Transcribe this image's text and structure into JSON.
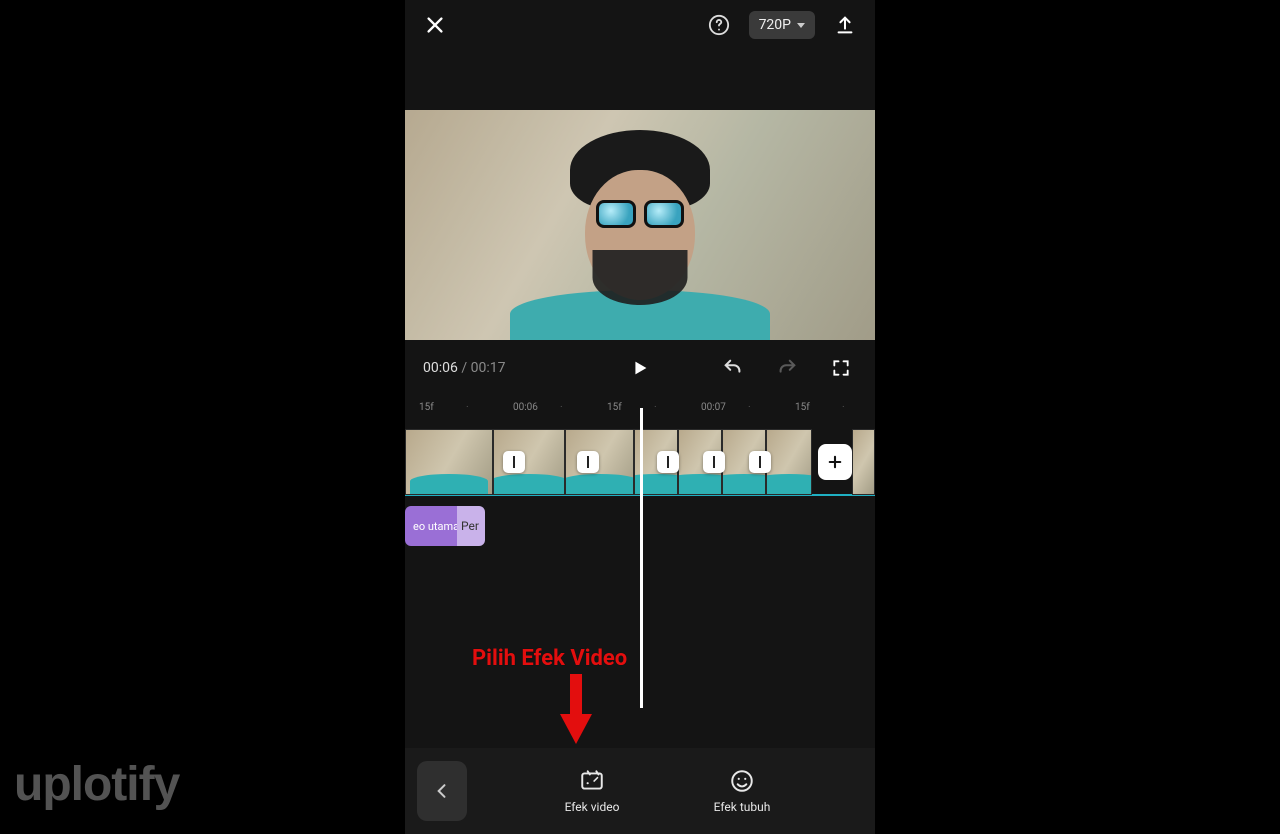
{
  "header": {
    "resolution_label": "720P"
  },
  "player": {
    "current_time": "00:06",
    "separator": " / ",
    "total_time": "00:17"
  },
  "ruler": {
    "ticks": [
      "15f",
      "·",
      "00:06",
      "·",
      "15f",
      "·",
      "00:07",
      "·",
      "15f",
      "·"
    ]
  },
  "tracks": {
    "tag_main": "eo utama",
    "tag_secondary": "Per"
  },
  "annotation": {
    "text": "Pilih Efek Video"
  },
  "bottombar": {
    "effect_video": "Efek video",
    "effect_body": "Efek tubuh"
  },
  "watermark": "uplotify",
  "colors": {
    "annotation": "#e30e0e",
    "accent_teal": "#1fb0c2",
    "tag_purple": "#9a6fd6"
  }
}
